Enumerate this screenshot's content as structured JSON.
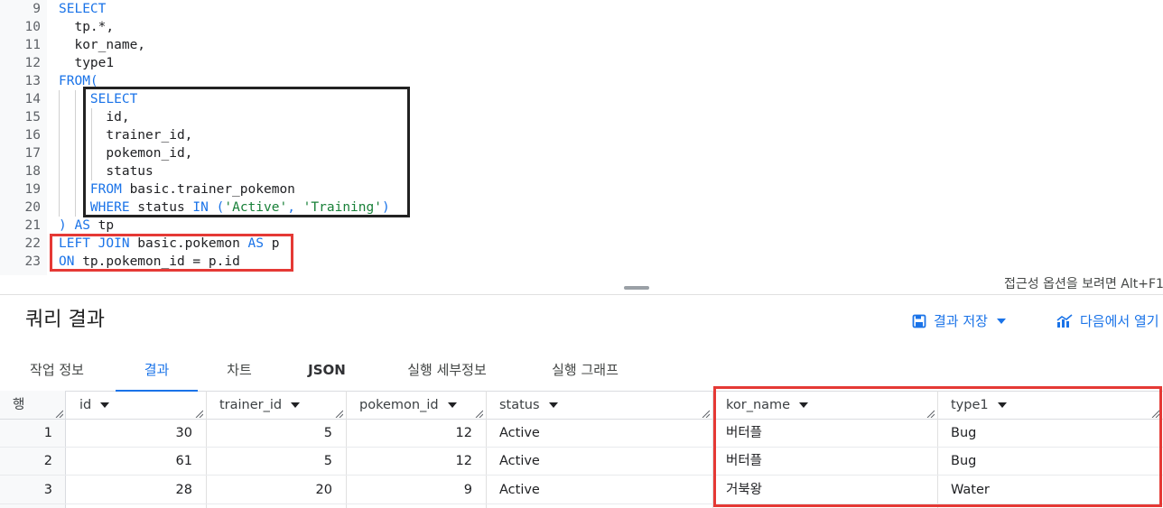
{
  "editor": {
    "lines": [
      {
        "n": "9",
        "tokens": [
          [
            "kw",
            "SELECT"
          ]
        ]
      },
      {
        "n": "10",
        "tokens": [
          [
            "id",
            "  tp.*,"
          ]
        ]
      },
      {
        "n": "11",
        "tokens": [
          [
            "id",
            "  kor_name,"
          ]
        ]
      },
      {
        "n": "12",
        "tokens": [
          [
            "id",
            "  type1"
          ]
        ]
      },
      {
        "n": "13",
        "tokens": [
          [
            "kw",
            "FROM("
          ]
        ]
      },
      {
        "n": "14",
        "tokens": [
          [
            "kw",
            "    SELECT"
          ]
        ]
      },
      {
        "n": "15",
        "tokens": [
          [
            "id",
            "      id,"
          ]
        ]
      },
      {
        "n": "16",
        "tokens": [
          [
            "id",
            "      trainer_id,"
          ]
        ]
      },
      {
        "n": "17",
        "tokens": [
          [
            "id",
            "      pokemon_id,"
          ]
        ]
      },
      {
        "n": "18",
        "tokens": [
          [
            "id",
            "      status"
          ]
        ]
      },
      {
        "n": "19",
        "tokens": [
          [
            "kw",
            "    FROM"
          ],
          [
            "id",
            " basic.trainer_pokemon"
          ]
        ]
      },
      {
        "n": "20",
        "tokens": [
          [
            "kw",
            "    WHERE"
          ],
          [
            "id",
            " status "
          ],
          [
            "kw",
            "IN"
          ],
          [
            "id",
            " "
          ],
          [
            "kw",
            "("
          ],
          [
            "str",
            "'Active'"
          ],
          [
            "kw",
            ", "
          ],
          [
            "str",
            "'Training'"
          ],
          [
            "kw",
            ")"
          ]
        ]
      },
      {
        "n": "21",
        "tokens": [
          [
            "kw",
            ") AS"
          ],
          [
            "id",
            " tp"
          ]
        ]
      },
      {
        "n": "22",
        "tokens": [
          [
            "kw",
            "LEFT JOIN"
          ],
          [
            "id",
            " basic.pokemon "
          ],
          [
            "kw",
            "AS"
          ],
          [
            "id",
            " p"
          ]
        ]
      },
      {
        "n": "23",
        "tokens": [
          [
            "kw",
            "ON"
          ],
          [
            "id",
            " tp.pokemon_id = p.id"
          ]
        ]
      }
    ]
  },
  "a11y_hint": "접근성 옵션을 보려면 Alt+F1",
  "results": {
    "title": "쿼리 결과",
    "save_label": "결과 저장",
    "open_label": "다음에서 열기"
  },
  "tabs": [
    "작업 정보",
    "결과",
    "차트",
    "JSON",
    "실행 세부정보",
    "실행 그래프"
  ],
  "active_tab": "결과",
  "table": {
    "row_header": "행",
    "columns": [
      "id",
      "trainer_id",
      "pokemon_id",
      "status",
      "kor_name",
      "type1"
    ],
    "rows": [
      {
        "row": "1",
        "id": "30",
        "trainer_id": "5",
        "pokemon_id": "12",
        "status": "Active",
        "kor_name": "버터플",
        "type1": "Bug"
      },
      {
        "row": "2",
        "id": "61",
        "trainer_id": "5",
        "pokemon_id": "12",
        "status": "Active",
        "kor_name": "버터플",
        "type1": "Bug"
      },
      {
        "row": "3",
        "id": "28",
        "trainer_id": "20",
        "pokemon_id": "9",
        "status": "Active",
        "kor_name": "거북왕",
        "type1": "Water"
      }
    ]
  },
  "colors": {
    "accent": "#1a73e8",
    "keyword": "#1a73e8",
    "string": "#188038",
    "highlight_red": "#e53935",
    "highlight_black": "#222222"
  }
}
